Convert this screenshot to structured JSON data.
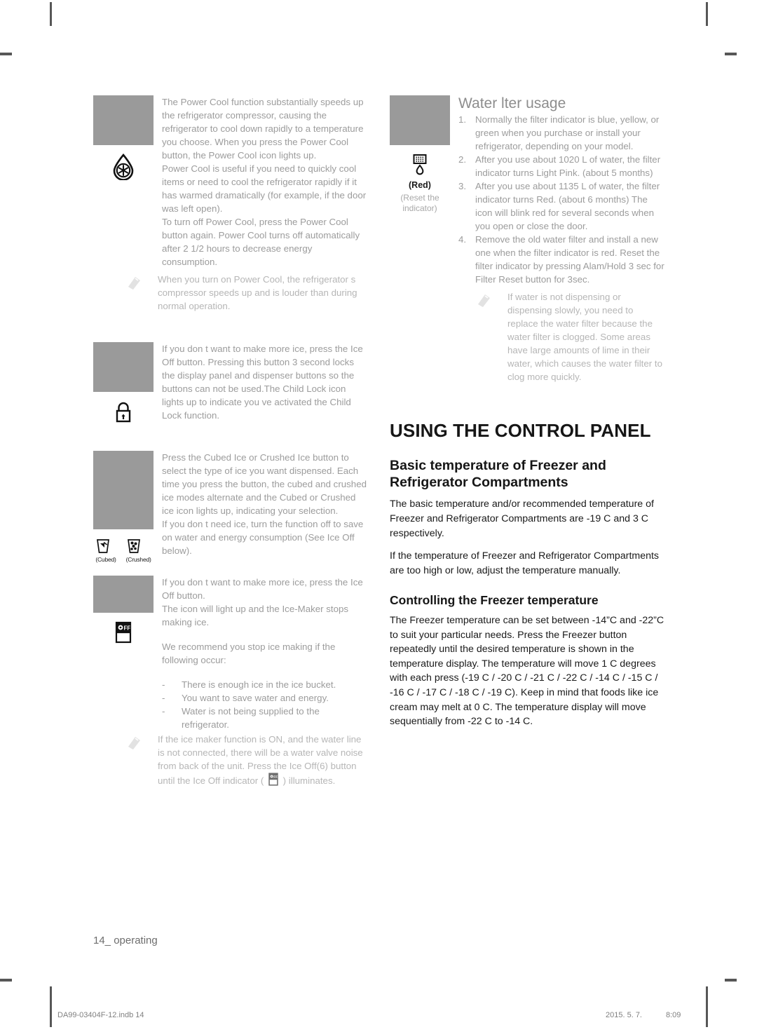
{
  "page": {
    "folio": "14_ operating",
    "footer_left": "DA99-03404F-12.indb   14",
    "footer_date": "2015. 5. 7.",
    "footer_time": "8:09"
  },
  "left_column": {
    "blocks": [
      {
        "icon": "water-drop-snowflake-icon",
        "text": "The Power Cool function substantially speeds up the refrigerator compressor, causing the refrigerator to cool down rapidly to a temperature you choose. When you press the Power Cool button, the Power Cool icon lights up.\nPower Cool is useful if you need to quickly cool items or need to cool the refrigerator rapidly if it has warmed dramatically (for example, if the door was left open).\nTo turn off Power Cool, press the Power Cool button again. Power Cool turns off automatically after 2 1/2 hours to decrease energy consumption.",
        "note": "When you turn on Power Cool, the refrigerator s compressor speeds up and is louder than during normal operation."
      },
      {
        "icon": "padlock-icon",
        "text": "If you don t want to make more ice, press the Ice Off button.  Pressing this button 3 second locks the display panel and dispenser buttons so the buttons can not be used.The Child Lock icon lights up to indicate you ve activated the Child Lock function."
      },
      {
        "icon": "cubed-crushed-ice-icons",
        "caption_cubed": "(Cubed)",
        "caption_crushed": "(Crushed)",
        "text": "Press the Cubed Ice or Crushed Ice button to select the type of ice you want dispensed. Each time you press the button, the cubed and crushed ice modes alternate and the Cubed or Crushed ice icon lights up, indicating your selection.\nIf you don t need ice, turn the function off to save on water and energy consumption (See Ice Off below)."
      },
      {
        "icon": "ice-off-icon",
        "text": "If you don t want to make more ice, press the Ice Off button.\nThe icon will light up and the Ice-Maker stops making ice.",
        "text2": "We recommend you stop ice making if the following occur:",
        "bullets": [
          "There is enough ice in the ice bucket.",
          "You want to save water and energy.",
          "Water is not being supplied to the refrigerator."
        ],
        "note_part1": "If the ice maker function is ON, and the water line is not connected, there will be a  water valve noise from back of the unit. Press the Ice Off(6) button until the Ice Off indicator ( ",
        "note_part2": " ) illuminates."
      }
    ]
  },
  "right_column": {
    "filter_section": {
      "heading": "Water  lter usage",
      "icon": "water-filter-icon",
      "caption": "(Red)",
      "subcaption": "(Reset the indicator)",
      "items": [
        {
          "num": "1.",
          "text": "Normally the filter indicator is blue, yellow, or green when you purchase or install your refrigerator, depending on your model."
        },
        {
          "num": "2.",
          "text": "After you use about 1020 L of water, the filter indicator turns Light Pink. (about 5 months)"
        },
        {
          "num": "3.",
          "text": "After you use about 1135 L of water, the filter indicator turns Red. (about 6 months) The icon will blink red for several seconds when you open or close the door."
        },
        {
          "num": "4.",
          "text": "Remove the old water filter and install a new one when the filter indicator is red. Reset the filter indicator by pressing Alam/Hold 3 sec for Filter Reset button for 3sec."
        }
      ],
      "note": "If water is not dispensing or dispensing slowly, you need to replace the water filter because the water filter is clogged. Some areas have large amounts of lime in their water, which causes the water filter to clog more quickly."
    },
    "control_panel": {
      "section_heading": "USING THE CONTROL PANEL",
      "sub_heading": "Basic temperature of Freezer and Refrigerator Compartments",
      "paragraph_1": "The basic temperature and/or recommended temperature of Freezer and Refrigerator Compartments are -19 C and 3 C respectively.",
      "paragraph_2": "If the temperature of Freezer and Refrigerator Compartments are too high or low, adjust the temperature manually.",
      "sub_heading_2": "Controlling the Freezer temperature",
      "paragraph_3": "The Freezer temperature can be set between -14”C and -22”C to suit your particular needs. Press the Freezer button repeatedly until the desired temperature is shown in the temperature display. The temperature will move 1 C degrees with each press (-19 C  /  -20 C  /  -21 C  /  -22 C  /  -14 C  /  -15 C  /  -16 C  /  -17 C  /  -18 C  /  -19 C). Keep in mind that foods like ice cream may melt at 0 C. The temperature display will move sequentially from -22 C to -14 C."
    }
  },
  "colors": {
    "placeholder_gray": "#9a9a9a",
    "body_gray": "#9c9c9c",
    "note_gray": "#b6b6b6",
    "heading_black": "#161616"
  }
}
